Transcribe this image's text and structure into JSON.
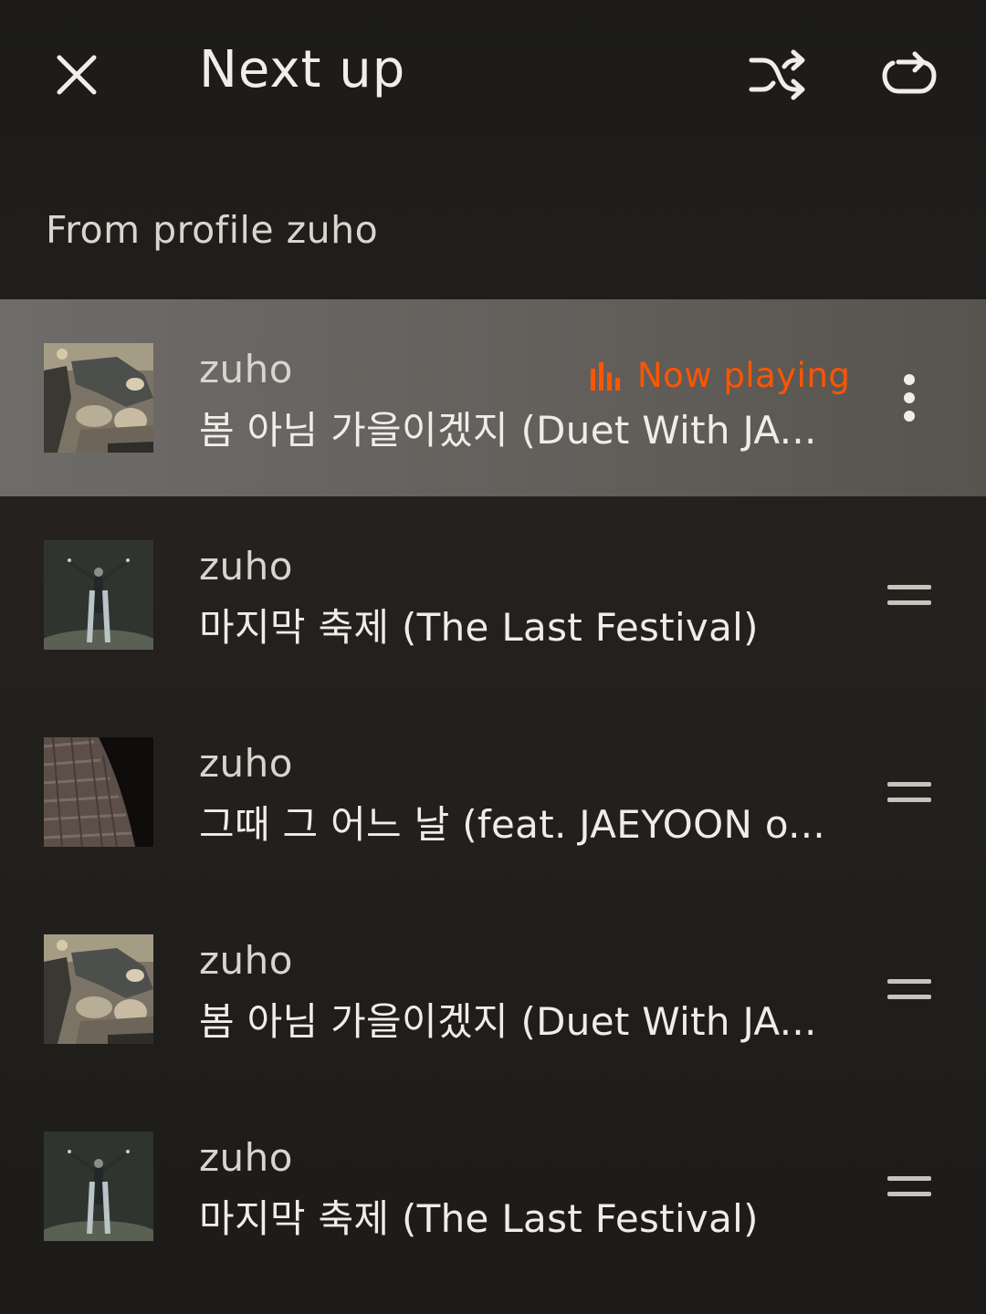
{
  "header": {
    "title": "Next up",
    "close_icon": "close-icon",
    "shuffle_icon": "shuffle-icon",
    "repeat_icon": "repeat-icon"
  },
  "source": {
    "label": "From profile zuho"
  },
  "colors": {
    "accent": "#ff5500",
    "current_row_bg": "#6a6764",
    "background": "#211f1c"
  },
  "queue": [
    {
      "artist": "zuho",
      "title": "봄 아님 가을이겠지 (Duet With JA...",
      "status": "Now playing",
      "artwork": "rocks-and-water"
    },
    {
      "artist": "zuho",
      "title": "마지막 축제 (The Last Festival)",
      "artwork": "figure-in-dark"
    },
    {
      "artist": "zuho",
      "title": "그때 그 어느 날 (feat. JAEYOON o...",
      "artwork": "knit-fabric"
    },
    {
      "artist": "zuho",
      "title": "봄 아님 가을이겠지 (Duet With JA...",
      "artwork": "rocks-and-water"
    },
    {
      "artist": "zuho",
      "title": "마지막 축제 (The Last Festival)",
      "artwork": "figure-in-dark"
    }
  ]
}
